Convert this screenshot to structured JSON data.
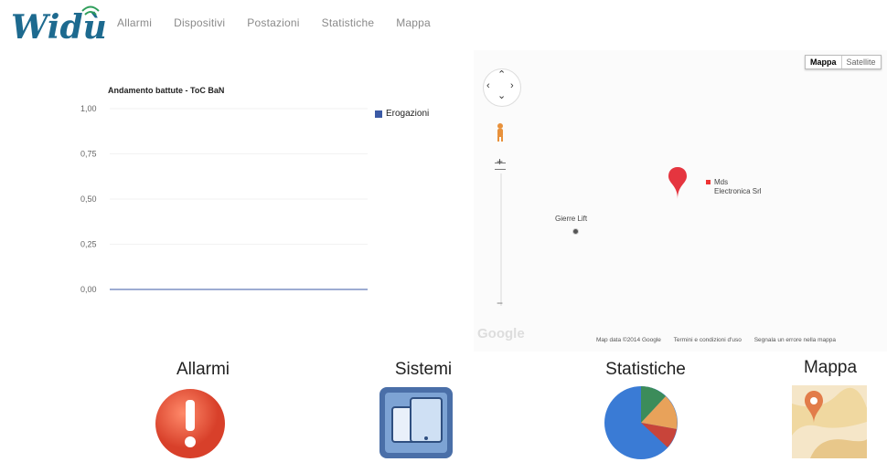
{
  "brand": {
    "logo_text": "Widù"
  },
  "nav": {
    "items": [
      "Allarmi",
      "Dispositivi",
      "Postazioni",
      "Statistiche",
      "Mappa"
    ]
  },
  "chart_data": {
    "type": "line",
    "title": "Andamento battute - ToC BaN",
    "yticks": [
      "1,00",
      "0,75",
      "0,50",
      "0,25",
      "0,00"
    ],
    "ylim": [
      0,
      1
    ],
    "series": [
      {
        "name": "Erogazioni",
        "values": [
          0,
          0
        ]
      }
    ],
    "legend": "top-right",
    "colors": {
      "series": "#3b5aa5"
    }
  },
  "map": {
    "type_buttons": [
      "Mappa",
      "Satellite"
    ],
    "places": [
      {
        "label": "Mds Electronica Srl",
        "line1": "Mds",
        "line2": "Electronica Srl"
      },
      {
        "label": "Gierre Lift"
      }
    ],
    "footer": [
      "Map data ©2014 Google",
      "Termini e condizioni d'uso",
      "Segnala un errore nella mappa"
    ],
    "google": "Google"
  },
  "tiles": [
    {
      "label": "Allarmi",
      "icon": "alarm-icon"
    },
    {
      "label": "Sistemi",
      "icon": "devices-icon"
    },
    {
      "label": "Statistiche",
      "icon": "pie-chart-icon"
    },
    {
      "label": "Mappa",
      "icon": "map-icon"
    }
  ]
}
